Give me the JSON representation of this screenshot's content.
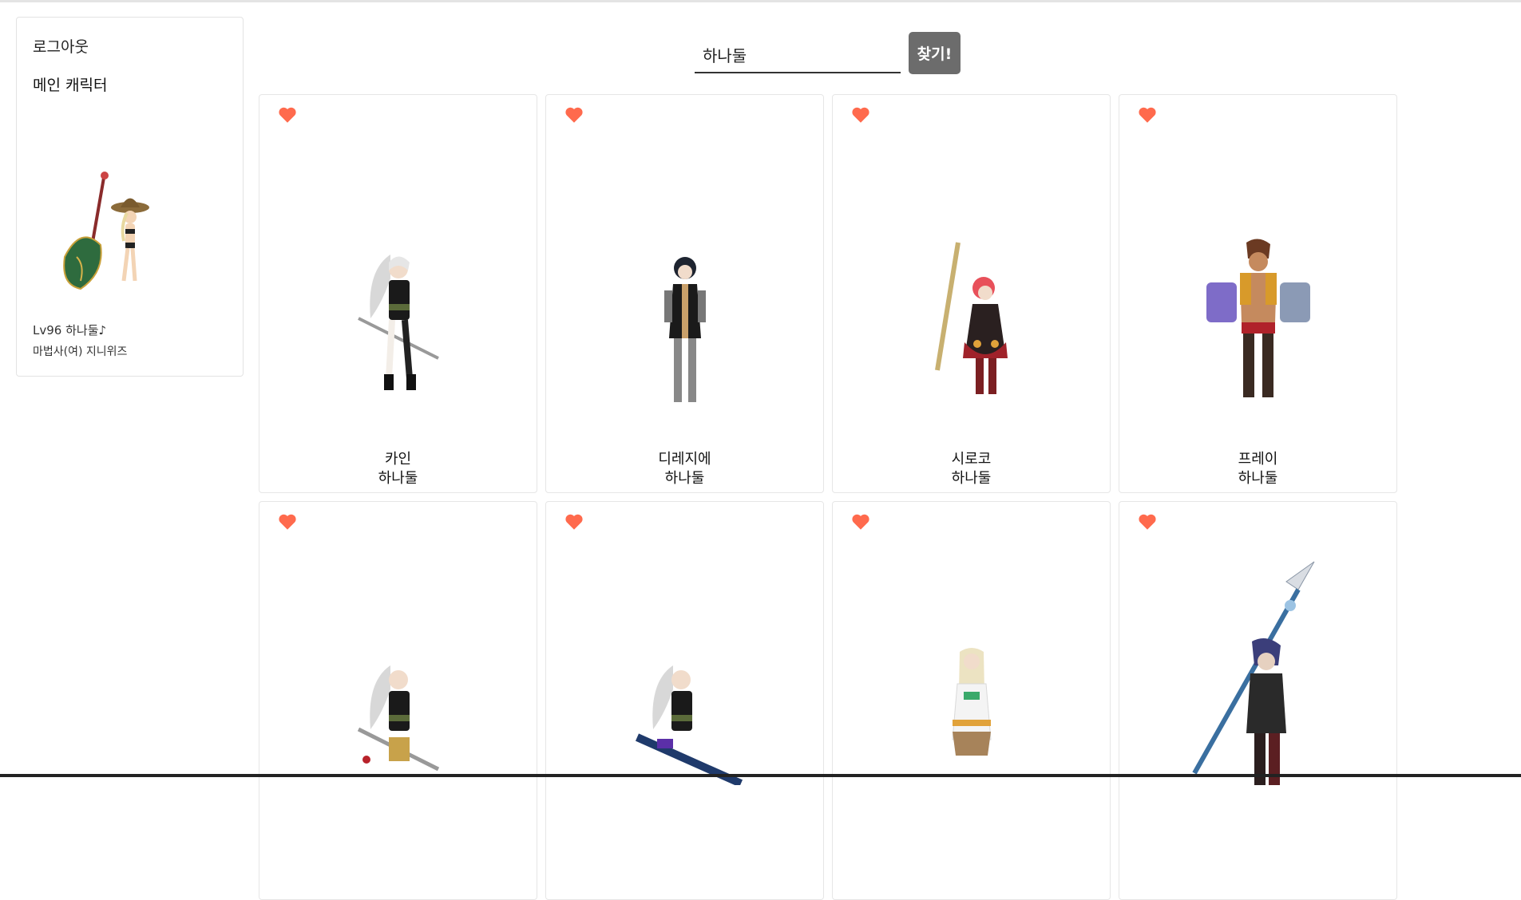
{
  "sidebar": {
    "logout_label": "로그아웃",
    "main_character_label": "메인 캐릭터",
    "main_level_text": "Lv96 하나둘♪",
    "main_job_text": "마법사(여) 지니위즈"
  },
  "search": {
    "value": "하나둘",
    "button_label": "찾기!"
  },
  "colors": {
    "heart": "#ff6a4d",
    "search_button": "#6c6c6c"
  },
  "characters": [
    {
      "server": "카인",
      "name": "하나둘",
      "icon": "heart-icon"
    },
    {
      "server": "디레지에",
      "name": "하나둘",
      "icon": "heart-icon"
    },
    {
      "server": "시로코",
      "name": "하나둘",
      "icon": "heart-icon"
    },
    {
      "server": "프레이",
      "name": "하나둘",
      "icon": "heart-icon"
    },
    {
      "server": "",
      "name": "",
      "icon": "heart-icon"
    },
    {
      "server": "",
      "name": "",
      "icon": "heart-icon"
    },
    {
      "server": "",
      "name": "",
      "icon": "heart-icon"
    },
    {
      "server": "",
      "name": "",
      "icon": "heart-icon"
    }
  ]
}
